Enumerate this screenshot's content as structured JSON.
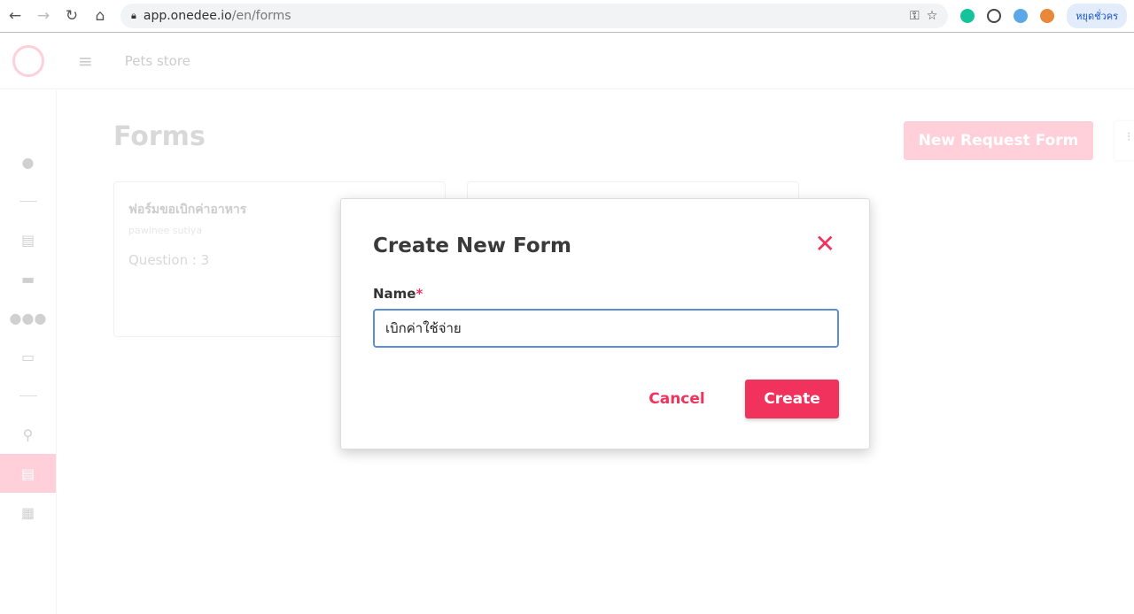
{
  "browser": {
    "url_host": "app.onedee.io",
    "url_path": "/en/forms",
    "profile_label": "หยุดชั่วคร"
  },
  "header": {
    "store_name": "Pets store"
  },
  "sidebar": {
    "items": [
      "user-circle-icon",
      "file-icon",
      "briefcase-clock-icon",
      "users-icon",
      "id-card-icon",
      "pin-icon",
      "clipboard-list-icon",
      "building-icon"
    ],
    "active": "clipboard-list-icon"
  },
  "page": {
    "title": "Forms",
    "new_button": "New Request Form"
  },
  "cards": [
    {
      "title": "ฟอร์มขอเบิกค่าอาหาร",
      "author": "pawinee sutiya",
      "questions": "Question : 3"
    }
  ],
  "modal": {
    "title": "Create New Form",
    "name_label": "Name",
    "required_mark": "*",
    "name_value": "เบิกค่าใช้จ่าย",
    "cancel": "Cancel",
    "create": "Create"
  },
  "colors": {
    "accent": "#f0325c",
    "accent_light": "#ffd0da",
    "focus": "#5b8ed6"
  }
}
